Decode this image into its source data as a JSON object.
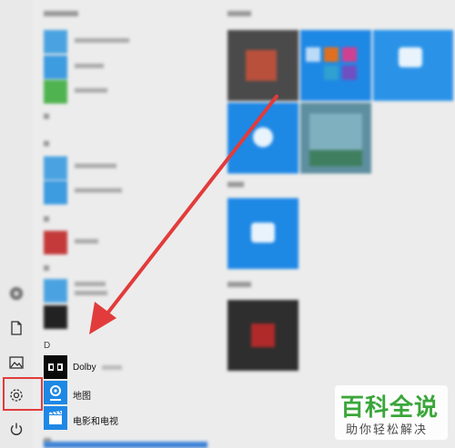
{
  "section_d": "D",
  "apps": {
    "dolby": "Dolby",
    "maps": "地图",
    "movies": "电影和电视"
  },
  "icons": {
    "rail_icon_1": "circle-dot-icon",
    "documents": "document-icon",
    "pictures": "picture-icon",
    "settings": "gear-icon",
    "power": "power-icon"
  },
  "colors": {
    "accent": "#1e88e5",
    "highlight": "#e23b3b",
    "arrow": "#e23b3b",
    "watermark": "#3aa63a"
  },
  "watermark": {
    "title": "百科全说",
    "subtitle": "助你轻松解决"
  }
}
